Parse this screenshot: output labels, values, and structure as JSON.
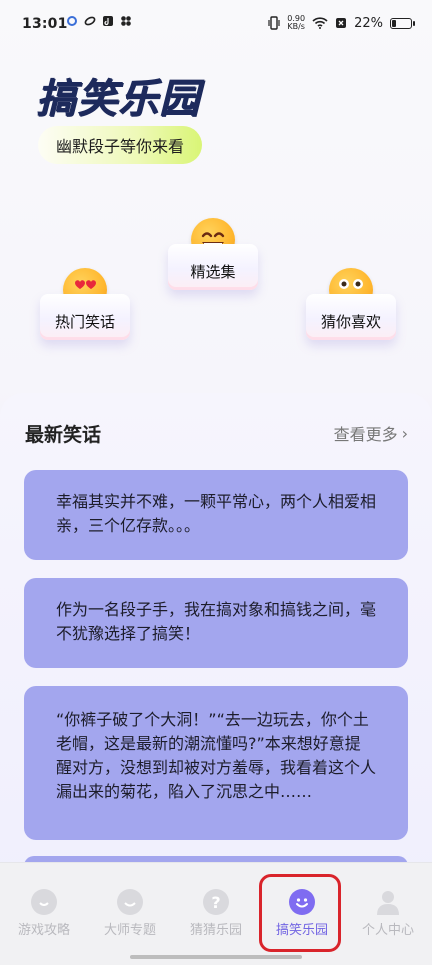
{
  "status_bar": {
    "time": "13:01",
    "net_speed_value": "0.90",
    "net_speed_unit": "KB/s",
    "battery": "22%"
  },
  "header": {
    "title": "搞笑乐园",
    "subtitle": "幽默段子等你来看"
  },
  "categories": [
    {
      "label": "热门笑话",
      "icon": "heart-eyes-emoji-icon"
    },
    {
      "label": "精选集",
      "icon": "grinning-emoji-icon"
    },
    {
      "label": "猜你喜欢",
      "icon": "silly-face-emoji-icon"
    }
  ],
  "latest": {
    "title": "最新笑话",
    "more_label": "查看更多",
    "jokes": [
      "幸福其实并不难，一颗平常心，两个人相爱相亲，三个亿存款。。。",
      "作为一名段子手，我在搞对象和搞钱之间，毫不犹豫选择了搞笑！",
      "“你裤子破了个大洞！”“去一边玩去，你个土老帽，这是最新的潮流懂吗?”本来想好意提醒对方，没想到却被对方羞辱，我看着这个人漏出来的菊花，陷入了沉思之中……"
    ]
  },
  "tabbar": {
    "tabs": [
      {
        "label": "游戏攻略",
        "icon": "game-guide-icon"
      },
      {
        "label": "大师专题",
        "icon": "master-topic-icon"
      },
      {
        "label": "猜猜乐园",
        "icon": "question-icon"
      },
      {
        "label": "搞笑乐园",
        "icon": "smile-icon"
      },
      {
        "label": "个人中心",
        "icon": "person-icon"
      }
    ],
    "active_index": 3
  },
  "colors": {
    "accent": "#7f6cf1",
    "card": "#a3a6ee",
    "title": "#1d2a5c",
    "highlight": "#d9242b"
  }
}
